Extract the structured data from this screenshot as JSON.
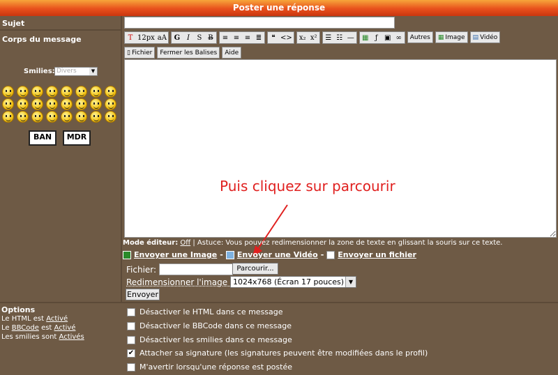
{
  "title": "Poster une réponse",
  "labels": {
    "subject": "Sujet",
    "body": "Corps du message",
    "smilies": "Smilies:",
    "smilies_select": "Divers"
  },
  "toolbar": {
    "font_size": "12px",
    "bold": "G",
    "italic": "I",
    "strike": "S",
    "underline": "B",
    "others": "Autres",
    "image": "Image",
    "video": "Vidéo",
    "file": "Fichier",
    "close_tags": "Fermer les Balises",
    "help": "Aide"
  },
  "annotation": "Puis cliquez sur parcourir",
  "mode_line": {
    "label": "Mode éditeur:",
    "value": "Off",
    "tip": " | Astuce: Vous pouvez redimensionner la zone de texte en glissant la souris sur ce texte."
  },
  "upload": {
    "send_image": "Envoyer une Image",
    "send_video": "Envoyer une Vidéo",
    "send_file": "Envoyer un fichier",
    "file_label": "Fichier:",
    "browse": "Parcourir...",
    "resize_label": "Redimensionner l'image ?",
    "resize_value": "1024x768 (Écran 17 pouces)",
    "submit": "Envoyer"
  },
  "options": {
    "heading": "Options",
    "html_prefix": "Le HTML est ",
    "html_status": "Activé",
    "bbcode_prefix": "Le ",
    "bbcode_link": "BBCode",
    "bbcode_mid": " est ",
    "bbcode_status": "Activé",
    "smilies_prefix": "Les smilies sont ",
    "smilies_status": "Activés"
  },
  "checkboxes": [
    {
      "label": "Désactiver le HTML dans ce message",
      "checked": false
    },
    {
      "label": "Désactiver le BBCode dans ce message",
      "checked": false
    },
    {
      "label": "Désactiver les smilies dans ce message",
      "checked": false
    },
    {
      "label": "Attacher sa signature (les signatures peuvent être modifiées dans le profil)",
      "checked": true
    },
    {
      "label": "M'avertir lorsqu'une réponse est postée",
      "checked": false
    }
  ],
  "signs": {
    "ban": "BAN",
    "mdr": "MDR"
  },
  "colors": {
    "background": "#6e5a45",
    "header": "#e8501c",
    "annotation": "#e0201f"
  }
}
